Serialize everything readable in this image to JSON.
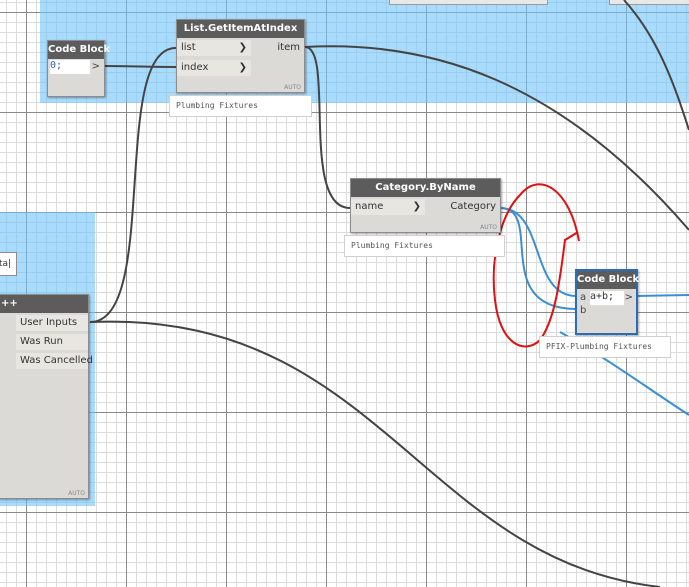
{
  "nodes": {
    "code_block_1": {
      "title": "Code Block",
      "code": "0;",
      "out": ">"
    },
    "get_item": {
      "title": "List.GetItemAtIndex",
      "inputs": [
        "list",
        "index"
      ],
      "output": "item",
      "lacing": "AUTO",
      "preview": "Plumbing Fixtures"
    },
    "category": {
      "title": "Category.ByName",
      "input": "name",
      "output": "Category",
      "lacing": "AUTO",
      "preview": "Plumbing Fixtures"
    },
    "code_block_2": {
      "title": "Code Block",
      "inputs": [
        "a",
        "b"
      ],
      "code": "a+b;",
      "out": ">",
      "preview": "PFIX-Plumbing Fixtures"
    },
    "dialog_node": {
      "title_fragment": "++",
      "outputs": [
        "User Inputs",
        "Was Run",
        "Was Cancelled"
      ],
      "lacing": "AUTO"
    },
    "input_fragment": {
      "text": "ta|"
    }
  },
  "colors": {
    "group_fill": "#6ec3fa",
    "wire_default": "#444444",
    "wire_selected": "#3a8fd4",
    "annotation": "#e01010",
    "header": "#5c5c5c"
  }
}
